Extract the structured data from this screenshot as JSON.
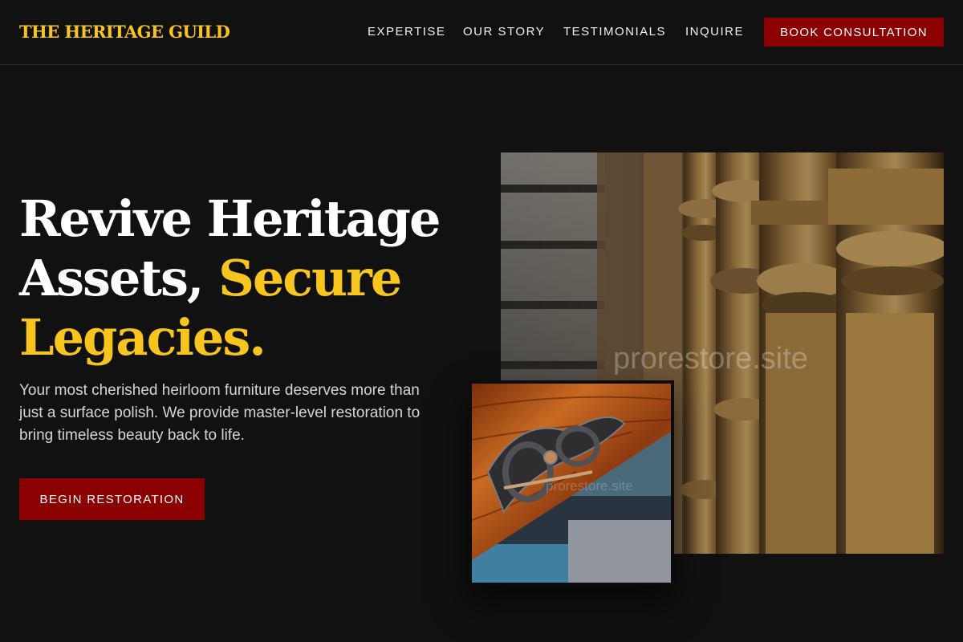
{
  "brand": {
    "name": "THE HERITAGE GUILD"
  },
  "nav": {
    "links": [
      "EXPERTISE",
      "OUR STORY",
      "TESTIMONIALS",
      "INQUIRE"
    ],
    "cta_label": "BOOK CONSULTATION"
  },
  "hero": {
    "headline_line1": "Revive Heritage",
    "headline_line2a": "Assets, ",
    "headline_line2b": "Secure",
    "headline_line3": "Legacies.",
    "subtext": "Your most cherished heirloom furniture deserves more than just a surface polish. We provide master-level restoration to bring timeless beauty back to life.",
    "cta_label": "BEGIN RESTORATION"
  },
  "images": {
    "main_watermark": "prorestore.site",
    "small_watermark": "prorestore.site"
  },
  "colors": {
    "background": "#111111",
    "accent_gold": "#f7c51e",
    "accent_red": "#8b0000"
  }
}
